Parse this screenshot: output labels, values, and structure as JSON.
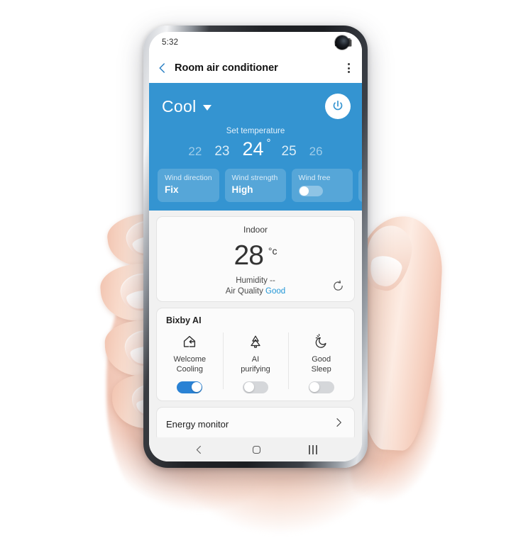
{
  "status_bar": {
    "time": "5:32",
    "signal_icon": "signal-bars-icon",
    "battery_icon": "battery-icon",
    "camera_icon": "front-camera-punch-hole"
  },
  "app_bar": {
    "back_icon": "chevron-left-icon",
    "title": "Room air conditioner",
    "more_icon": "more-vertical-icon"
  },
  "control_panel": {
    "mode": "Cool",
    "mode_caret_icon": "chevron-down-icon",
    "power_icon": "power-icon",
    "power_state": "on",
    "set_temperature_label": "Set temperature",
    "temperatures": [
      "22",
      "23",
      "24",
      "25",
      "26"
    ],
    "selected_temperature": "24",
    "degree_symbol": "°",
    "chips": [
      {
        "label": "Wind direction",
        "value": "Fix",
        "type": "value"
      },
      {
        "label": "Wind strength",
        "value": "High",
        "type": "value"
      },
      {
        "label": "Wind free",
        "value": "",
        "type": "toggle",
        "state": "off"
      }
    ],
    "accent_color": "#3494d1"
  },
  "indoor": {
    "title": "Indoor",
    "temperature": "28",
    "unit": "°c",
    "humidity_text": "Humidity --",
    "air_quality_label": "Air Quality",
    "air_quality_value": "Good",
    "air_quality_color": "#2196d6",
    "refresh_icon": "refresh-icon"
  },
  "bixby": {
    "title": "Bixby AI",
    "items": [
      {
        "label": "Welcome\nCooling",
        "icon": "home-arrive-icon",
        "toggle": "on"
      },
      {
        "label": "AI\npurifying",
        "icon": "tree-purify-icon",
        "toggle": "off"
      },
      {
        "label": "Good\nSleep",
        "icon": "moon-sleep-icon",
        "toggle": "off"
      }
    ],
    "toggle_on_color": "#2a82d4"
  },
  "energy": {
    "label": "Energy monitor",
    "chevron_icon": "chevron-right-icon"
  },
  "nav_bar": {
    "back_icon": "nav-back-icon",
    "home_icon": "nav-home-icon",
    "recents_icon": "nav-recents-icon"
  }
}
